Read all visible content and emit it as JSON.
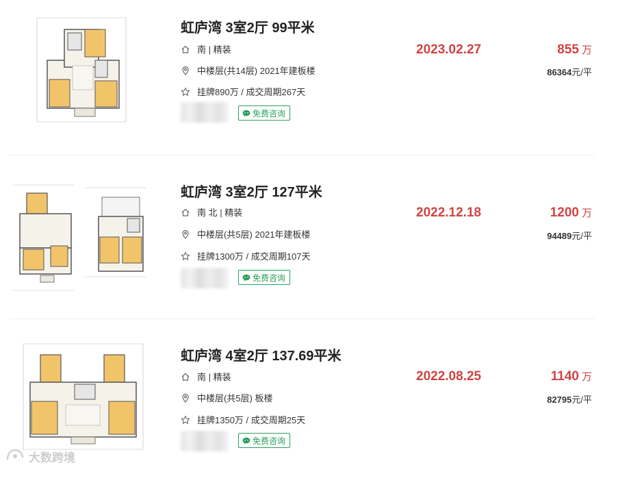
{
  "listings": [
    {
      "title": "虹庐湾 3室2厅 99平米",
      "orientation": "南 | 精装",
      "floor": "中楼层(共14层) 2021年建板楼",
      "listing_info": "挂牌890万 / 成交周期267天",
      "consult_label": "免费咨询",
      "deal_date": "2023.02.27",
      "total_price": "855",
      "price_unit": "万",
      "unit_price_value": "86364",
      "unit_price_suffix": "元/平"
    },
    {
      "title": "虹庐湾 3室2厅 127平米",
      "orientation": "南 北 | 精装",
      "floor": "中楼层(共5层) 2021年建板楼",
      "listing_info": "挂牌1300万 / 成交周期107天",
      "consult_label": "免费咨询",
      "deal_date": "2022.12.18",
      "total_price": "1200",
      "price_unit": "万",
      "unit_price_value": "94489",
      "unit_price_suffix": "元/平"
    },
    {
      "title": "虹庐湾 4室2厅 137.69平米",
      "orientation": "南 | 精装",
      "floor": "中楼层(共5层) 板楼",
      "listing_info": "挂牌1350万 / 成交周期25天",
      "consult_label": "免费咨询",
      "deal_date": "2022.08.25",
      "total_price": "1140",
      "price_unit": "万",
      "unit_price_value": "82795",
      "unit_price_suffix": "元/平"
    }
  ],
  "watermark": "大数跨境",
  "icons": {
    "orientation": "house-icon",
    "floor": "location-pin-icon",
    "listing_info": "star-icon",
    "consult": "wechat-icon"
  },
  "colors": {
    "accent_red": "#d04343",
    "consult_green": "#2aa05a",
    "room_yellow": "#f2c46a"
  }
}
